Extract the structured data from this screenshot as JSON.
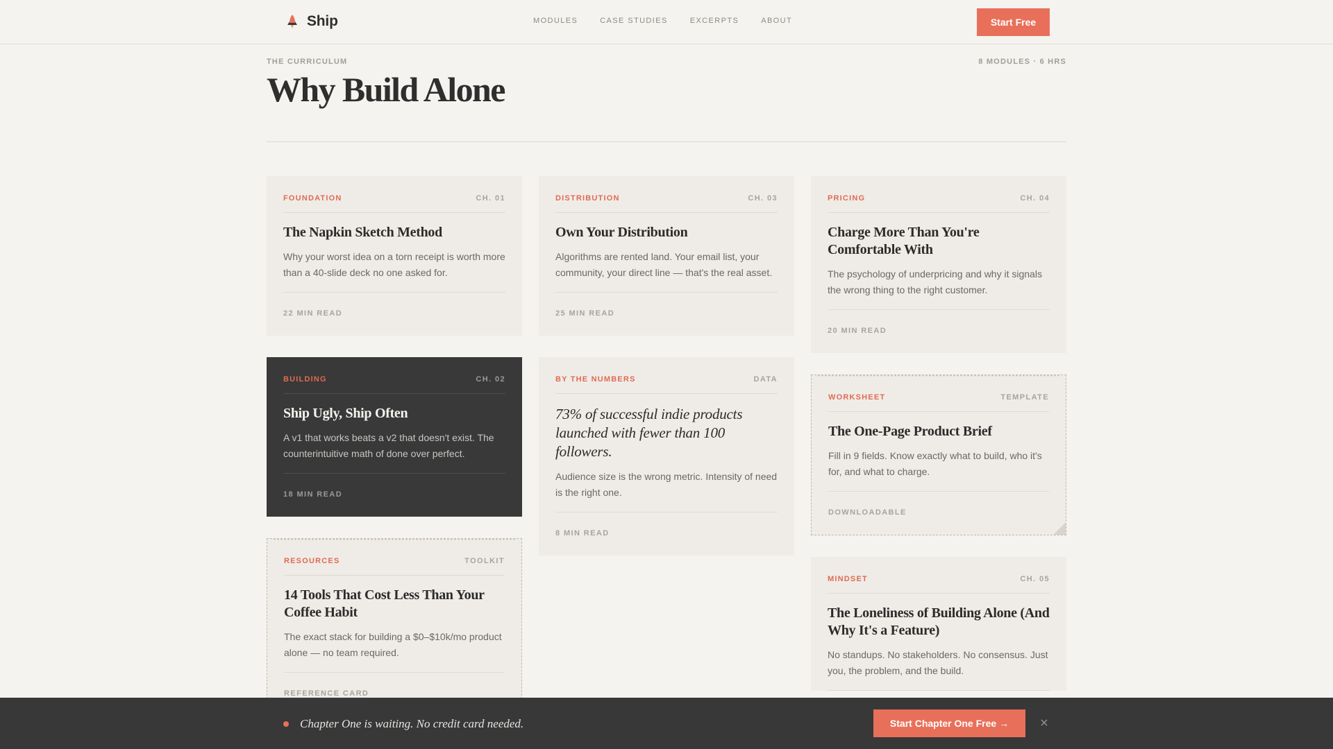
{
  "nav": {
    "brand": "Ship",
    "links": [
      "MODULES",
      "CASE STUDIES",
      "EXCERPTS",
      "ABOUT"
    ],
    "cta": "Start Free"
  },
  "header": {
    "eyebrow": "THE CURRICULUM",
    "meta": "8 MODULES · 6 HRS",
    "title": "Why Build Alone"
  },
  "cards": [
    {
      "tag": "FOUNDATION",
      "chapter": "CH. 01",
      "title": "The Napkin Sketch Method",
      "desc": "Why your worst idea on a torn receipt is worth more than a 40-slide deck no one asked for.",
      "foot": "22 MIN READ"
    },
    {
      "tag": "BUILDING",
      "chapter": "CH. 02",
      "title": "Ship Ugly, Ship Often",
      "desc": "A v1 that works beats a v2 that doesn't exist. The counterintuitive math of done over perfect.",
      "foot": "18 MIN READ"
    },
    {
      "tag": "RESOURCES",
      "chapter": "TOOLKIT",
      "title": "14 Tools That Cost Less Than Your Coffee Habit",
      "desc": "The exact stack for building a $0–$10k/mo product alone — no team required.",
      "foot": "REFERENCE CARD"
    },
    {
      "tag": "DISTRIBUTION",
      "chapter": "CH. 03",
      "title": "Own Your Distribution",
      "desc": "Algorithms are rented land. Your email list, your community, your direct line — that's the real asset.",
      "foot": "25 MIN READ"
    },
    {
      "tag": "BY THE NUMBERS",
      "chapter": "DATA",
      "title": "73% of successful indie products launched with fewer than 100 followers.",
      "desc": "Audience size is the wrong metric. Intensity of need is the right one.",
      "foot": "8 MIN READ"
    },
    {
      "tag": "PRICING",
      "chapter": "CH. 04",
      "title": "Charge More Than You're Comfortable With",
      "desc": "The psychology of underpricing and why it signals the wrong thing to the right customer.",
      "foot": "20 MIN READ"
    },
    {
      "tag": "WORKSHEET",
      "chapter": "TEMPLATE",
      "title": "The One-Page Product Brief",
      "desc": "Fill in 9 fields. Know exactly what to build, who it's for, and what to charge.",
      "foot": "DOWNLOADABLE"
    },
    {
      "tag": "MINDSET",
      "chapter": "CH. 05",
      "title": "The Loneliness of Building Alone (And Why It's a Feature)",
      "desc": "No standups. No stakeholders. No consensus. Just you, the problem, and the build.",
      "foot": ""
    }
  ],
  "bar": {
    "message": "Chapter One is waiting. No credit card needed.",
    "cta": "Start Chapter One Free →",
    "close": "×"
  },
  "colors": {
    "accent": "#e8705a",
    "background": "#f5f3ef",
    "card": "#efece7",
    "dark": "#393939"
  }
}
